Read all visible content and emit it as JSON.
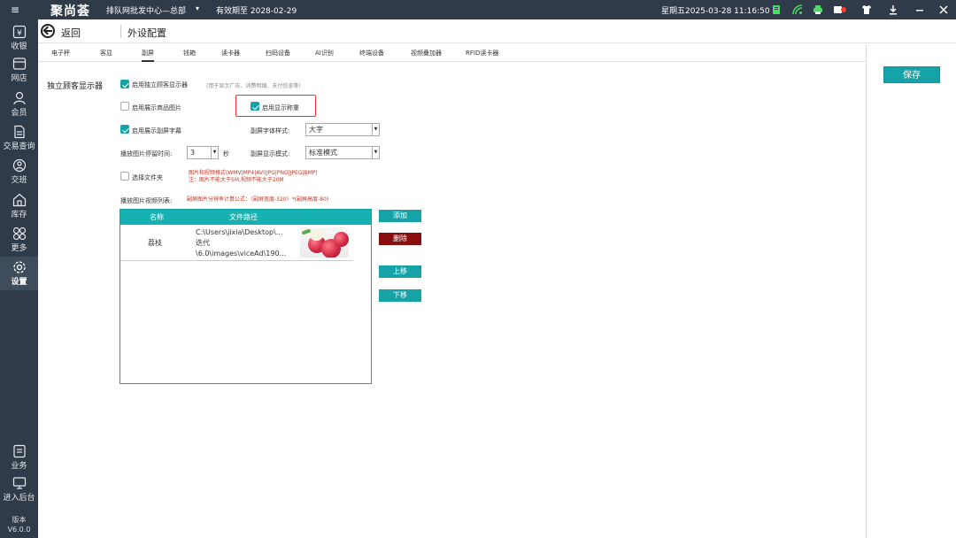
{
  "topbar": {
    "menu_icon": "≡",
    "brand": "聚尚荟",
    "store": "排队网批发中心—总部",
    "caret": "▾",
    "expire": "有效期至 2028-02-29",
    "clock": "星期五2025-03-28 11:16:50",
    "icons": [
      "printer-status-icon",
      "wifi-icon",
      "printer-icon",
      "card-reader-icon",
      "shirt-icon",
      "download-icon",
      "minimize-icon",
      "close-icon"
    ],
    "icon_colors": {
      "status": "#4cd964",
      "alert": "#ff3b30"
    }
  },
  "sidebar": {
    "items": [
      {
        "label": "收银",
        "icon": "cashier-icon"
      },
      {
        "label": "网店",
        "icon": "store-icon"
      },
      {
        "label": "会员",
        "icon": "member-icon"
      },
      {
        "label": "交易查询",
        "icon": "transaction-icon"
      },
      {
        "label": "交班",
        "icon": "shift-icon"
      },
      {
        "label": "库存",
        "icon": "inventory-icon"
      },
      {
        "label": "更多",
        "icon": "more-icon"
      },
      {
        "label": "设置",
        "icon": "settings-icon"
      }
    ],
    "bottom": [
      {
        "label": "业务",
        "icon": "business-icon"
      },
      {
        "label": "进入后台",
        "icon": "backend-icon"
      }
    ],
    "version_label": "版本",
    "version": "V6.0.0"
  },
  "header": {
    "back_label": "返回",
    "title": "外设配置"
  },
  "tabs": [
    "电子秤",
    "客显",
    "副屏",
    "钱箱",
    "读卡器",
    "扫码设备",
    "AI识别",
    "终端设备",
    "视频叠加器",
    "RFID读卡器"
  ],
  "active_tab": "副屏",
  "form": {
    "section_title": "独立顾客显示器",
    "enable_display": {
      "label": "启用独立顾客显示器",
      "checked": true,
      "hint": "(用于显示广告、消费明细、支付信息等)"
    },
    "show_product_image": {
      "label": "启用展示商品图片",
      "checked": false
    },
    "show_weight": {
      "label": "启用显示称重",
      "checked": true
    },
    "show_subtitle": {
      "label": "启用展示副屏字幕",
      "checked": true
    },
    "font_style": {
      "label": "副屏字体样式:",
      "value": "大字"
    },
    "dwell_time": {
      "label": "播放图片停留时间:",
      "value": "3",
      "unit": "秒"
    },
    "display_mode": {
      "label": "副屏显示模式:",
      "value": "标准模式"
    },
    "select_folder": {
      "label": "选择文件夹",
      "checked": false
    },
    "format_note": "图片和视频格式(WMV|MP4|AVI|JPG|PNG|JPEG|BMP)",
    "size_note": "注：图片不能大于5M,视频不能大于20M",
    "list_label": "播放图片视频列表:",
    "resolution_note": "副屏图片分辨率计算公式：（副屏宽度-320）*(副屏高度-80)"
  },
  "table": {
    "headers": [
      "名称",
      "文件路径"
    ],
    "rows": [
      {
        "name": "荔枝",
        "path": [
          "C:\\Users\\jixia\\Desktop\\...",
          "迭代",
          "\\6.0\\images\\viceAd\\190..."
        ]
      }
    ]
  },
  "buttons": {
    "add": "添加",
    "delete": "删除",
    "up": "上移",
    "down": "下移",
    "save": "保存"
  },
  "colors": {
    "sidebar_bg": "#2f3b48",
    "accent": "#16a3a8",
    "delete": "#8b0e0e",
    "highlight": "#e53935"
  }
}
